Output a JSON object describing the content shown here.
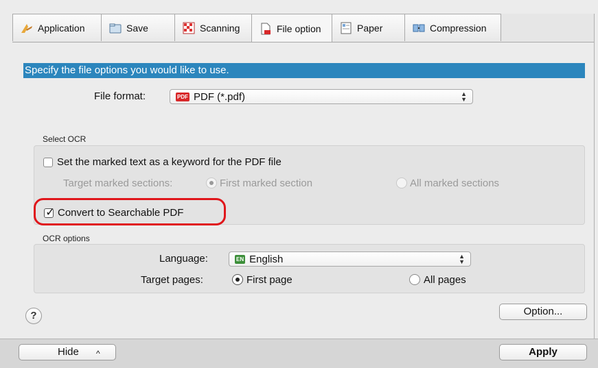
{
  "tabs": [
    {
      "label": "Application",
      "icon": "application-icon",
      "active": false
    },
    {
      "label": "Save",
      "icon": "folder-icon",
      "active": false
    },
    {
      "label": "Scanning",
      "icon": "scanning-icon",
      "active": false
    },
    {
      "label": "File option",
      "icon": "file-option-icon",
      "active": true
    },
    {
      "label": "Paper",
      "icon": "paper-icon",
      "active": false
    },
    {
      "label": "Compression",
      "icon": "compression-icon",
      "active": false
    }
  ],
  "header": {
    "text": "Specify the file options you would like to use."
  },
  "file_format": {
    "label": "File format:",
    "value": "PDF (*.pdf)",
    "badge": "PDF"
  },
  "select_ocr": {
    "title": "Select OCR",
    "keyword_checkbox": {
      "label": "Set the marked text as a keyword for the PDF file",
      "checked": false
    },
    "target_marked_label": "Target marked sections:",
    "first_marked": {
      "label": "First marked section",
      "selected": true,
      "enabled": false
    },
    "all_marked": {
      "label": "All marked sections",
      "selected": false,
      "enabled": false
    },
    "searchable_checkbox": {
      "label": "Convert to Searchable PDF",
      "checked": true
    }
  },
  "ocr_options": {
    "title": "OCR options",
    "language_label": "Language:",
    "language_value": "English",
    "language_badge": "EN",
    "target_pages_label": "Target pages:",
    "first_page": {
      "label": "First page",
      "selected": true
    },
    "all_pages": {
      "label": "All pages",
      "selected": false
    }
  },
  "buttons": {
    "option": "Option...",
    "help": "?",
    "hide": "Hide",
    "hide_caret": "^",
    "apply": "Apply"
  },
  "colors": {
    "header_bar": "#2c86bd",
    "highlight": "#e0161b",
    "pdf_badge": "#d8282a",
    "en_badge": "#3d8f3a"
  }
}
